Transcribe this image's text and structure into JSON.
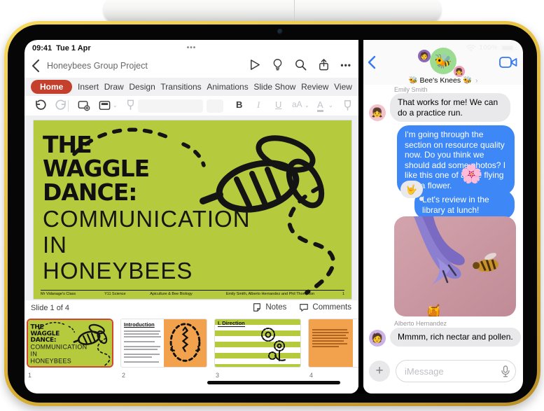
{
  "powerpoint": {
    "status_bar": {
      "time": "09:41",
      "date": "Tue 1 Apr",
      "window_dots": "•••"
    },
    "nav": {
      "title": "Honeybees Group Project",
      "more_label": "•••"
    },
    "ribbon_tabs": [
      "Home",
      "Insert",
      "Draw",
      "Design",
      "Transitions",
      "Animations",
      "Slide Show",
      "Review",
      "View"
    ],
    "selected_tab": "Home",
    "format_bar": {
      "bold": "B",
      "italic": "I",
      "underline": "U",
      "case": "aA",
      "font_color": "A"
    },
    "slide": {
      "title_lines": [
        "THE",
        "WAGGLE",
        "DANCE:"
      ],
      "subtitle_lines": [
        "COMMUNICATION",
        "IN",
        "HONEYBEES"
      ],
      "footer": {
        "class": "Mr Vidanage's Class",
        "subject": "Y11 Science",
        "topic": "Apiculture & Bee Biology",
        "authors": "Emily Smith, Alberto Hernandez and Phil Thompson",
        "page": "1"
      }
    },
    "status_row": {
      "counter": "Slide 1 of 4",
      "notes": "Notes",
      "comments": "Comments"
    },
    "thumbnails": [
      {
        "number": "1"
      },
      {
        "number": "2",
        "title": "Introduction"
      },
      {
        "number": "3",
        "title": "I. Direction"
      },
      {
        "number": "4"
      }
    ],
    "accent_color": "#c5402c",
    "slide_green": "#b5ca3d",
    "thumb_orange": "#f2a24c"
  },
  "messages": {
    "status": {
      "window_dots": "•••",
      "battery": "100%"
    },
    "header": {
      "group_name": "Bee's Knees",
      "name_prefix": "🐝",
      "name_suffix": "🐝",
      "chevron": "›",
      "group_avatar_emoji": "🐝",
      "member_avatar_1": "🧑",
      "member_avatar_2": "👧"
    },
    "thread": {
      "sender1": "Emily Smith",
      "msg1": "That works for me! We can do a practice run.",
      "avatar1": "👧",
      "msg2": "I'm going through the section on resource quality now. Do you think we should add some photos? I like this one of a bee flying into a flower.",
      "msg2_sticker": "🌸",
      "msg3_tapback": "🤟",
      "msg3": "Let's review in the library at lunch!",
      "photo_sticker": "🍯",
      "sender2": "Alberto Hernandez",
      "msg4": "Mmmm, rich nectar and pollen.",
      "avatar2": "🧑"
    },
    "composer": {
      "placeholder": "iMessage",
      "plus": "+"
    },
    "bubble_blue": "#3d87f6",
    "bubble_gray": "#e9e9eb"
  }
}
